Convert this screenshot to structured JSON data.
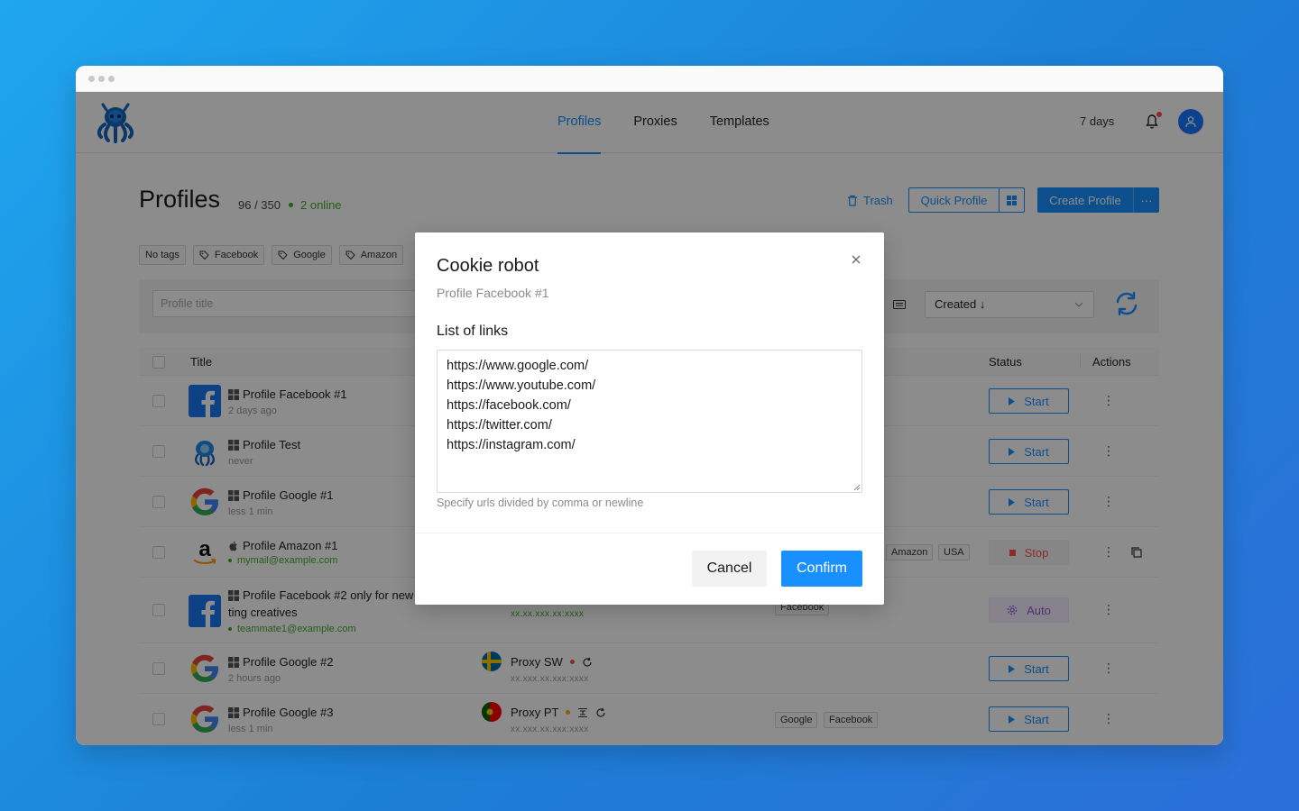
{
  "window": {
    "title": ""
  },
  "header": {
    "nav": [
      {
        "label": "Profiles",
        "active": true
      },
      {
        "label": "Proxies",
        "active": false
      },
      {
        "label": "Templates",
        "active": false
      }
    ],
    "plan_days": "7 days",
    "notification_icon": "bell-icon",
    "avatar_icon": "user-icon"
  },
  "page": {
    "title": "Profiles",
    "count": "96 / 350",
    "online": "2 online",
    "trash_label": "Trash",
    "quick_profile_label": "Quick Profile",
    "create_profile_label": "Create Profile",
    "more_label": "···"
  },
  "tags": [
    {
      "label": "No tags",
      "icon": false
    },
    {
      "label": "Facebook",
      "icon": true
    },
    {
      "label": "Google",
      "icon": true
    },
    {
      "label": "Amazon",
      "icon": true
    }
  ],
  "filters": {
    "search_placeholder": "Profile title",
    "sort_label": "Created ↓"
  },
  "table": {
    "columns": {
      "title": "Title",
      "status": "Status",
      "actions": "Actions"
    },
    "rows": [
      {
        "name": "Profile Facebook #1",
        "sub": "2 days ago",
        "icon": "facebook",
        "os": "windows",
        "status": "Start"
      },
      {
        "name": "Profile Test",
        "sub": "never",
        "icon": "octo",
        "os": "windows",
        "status": "Start"
      },
      {
        "name": "Profile Google #1",
        "sub": "less 1 min",
        "icon": "google",
        "os": "windows",
        "status": "Start"
      },
      {
        "name": "Profile Amazon #1",
        "sub": "mymail@example.com",
        "icon": "amazon",
        "os": "apple",
        "status": "Stop",
        "tags": [
          "Amazon",
          "USA"
        ]
      },
      {
        "name": "Profile Facebook #2 only for new",
        "name2": "ting creatives",
        "sub": "teammate1@example.com",
        "icon": "facebook",
        "os": "windows",
        "status": "Auto",
        "proxy_sub": "xx.xx.xxx.xx:xxxx",
        "tags": [
          "Facebook"
        ]
      },
      {
        "name": "Profile Google #2",
        "sub": "2 hours ago",
        "icon": "google",
        "os": "windows",
        "status": "Start",
        "proxy": "Proxy SW",
        "proxy_sub": "xx.xxx.xx.xxx:xxxx"
      },
      {
        "name": "Profile Google #3",
        "sub": "less 1 min",
        "icon": "google",
        "os": "windows",
        "status": "Start",
        "proxy": "Proxy PT",
        "proxy_sub": "xx.xxx.xx.xxx:xxxx",
        "tags": [
          "Google",
          "Facebook"
        ]
      }
    ]
  },
  "modal": {
    "title": "Cookie robot",
    "subtitle": "Profile Facebook #1",
    "list_label": "List of links",
    "links": "https://www.google.com/\nhttps://www.youtube.com/\nhttps://facebook.com/\nhttps://twitter.com/\nhttps://instagram.com/",
    "hint": "Specify urls divided by comma or newline",
    "cancel_label": "Cancel",
    "confirm_label": "Confirm"
  },
  "colors": {
    "accent": "#1890ff",
    "online": "#3fae2a",
    "stop": "#ff4d4f",
    "auto": "#9254de"
  }
}
